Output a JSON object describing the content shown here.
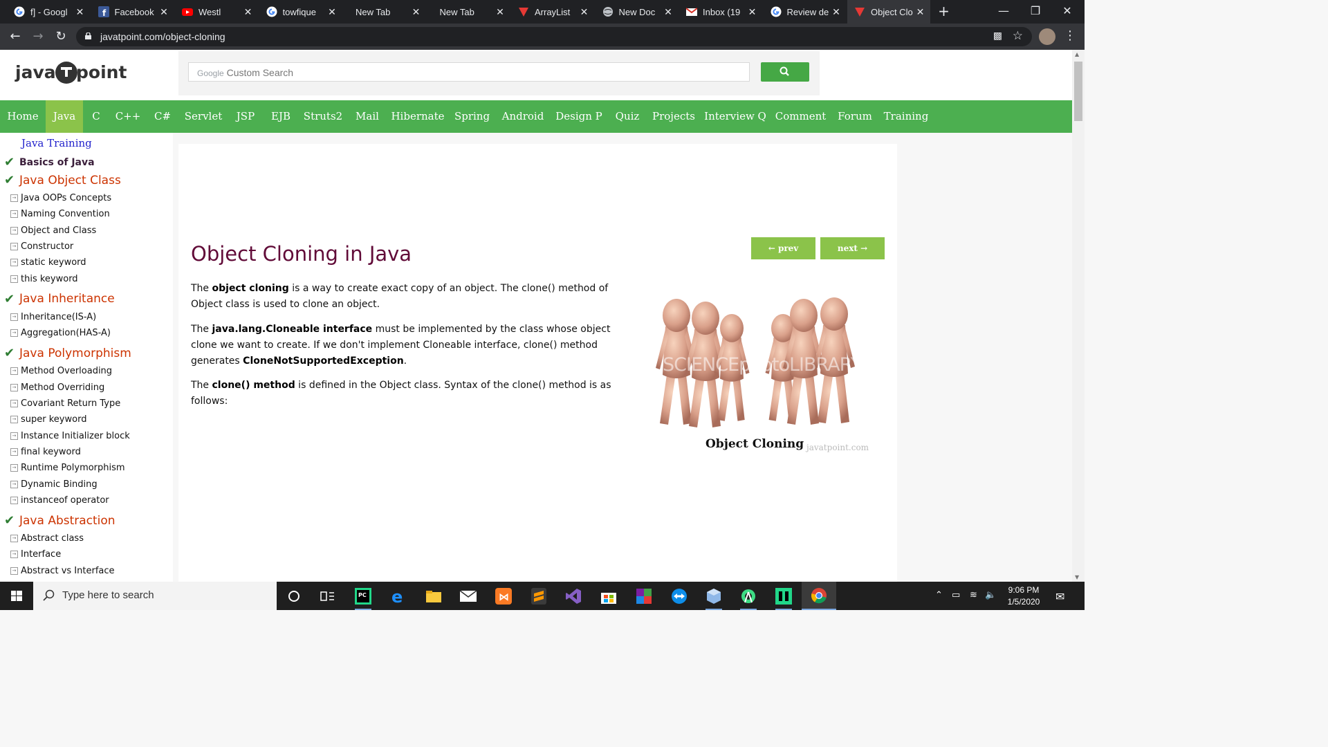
{
  "browser": {
    "tabs": [
      {
        "title": "f] - Googl",
        "icon": "google-icon",
        "active": false
      },
      {
        "title": "Facebook",
        "icon": "facebook-icon",
        "active": false
      },
      {
        "title": "Westl",
        "icon": "youtube-icon",
        "active": false
      },
      {
        "title": "towfique",
        "icon": "google-icon",
        "active": false
      },
      {
        "title": "New Tab",
        "icon": "none",
        "active": false
      },
      {
        "title": "New Tab",
        "icon": "none",
        "active": false
      },
      {
        "title": "ArrayList",
        "icon": "javatpoint-icon",
        "active": false
      },
      {
        "title": "New Doc",
        "icon": "globe-icon",
        "active": false
      },
      {
        "title": "Inbox (19",
        "icon": "gmail-icon",
        "active": false
      },
      {
        "title": "Review de",
        "icon": "google-icon",
        "active": false
      },
      {
        "title": "Object Clo",
        "icon": "javatpoint-icon",
        "active": true
      }
    ],
    "url": "javatpoint.com/object-cloning"
  },
  "site": {
    "logo_left": "java",
    "logo_right": "point",
    "search_brand": "Google",
    "search_placeholder": "Custom Search",
    "nav": [
      "Home",
      "Java",
      "C",
      "C++",
      "C#",
      "Servlet",
      "JSP",
      "EJB",
      "Struts2",
      "Mail",
      "Hibernate",
      "Spring",
      "Android",
      "Design P",
      "Quiz",
      "Projects",
      "Interview Q",
      "Comment",
      "Forum",
      "Training"
    ],
    "nav_active": "Java"
  },
  "sidebar": {
    "heading": "Java Training",
    "sections": [
      {
        "title": "Basics of Java",
        "style": "basic",
        "items": []
      },
      {
        "title": "Java Object Class",
        "style": "big",
        "items": [
          "Java OOPs Concepts",
          "Naming Convention",
          "Object and Class",
          "Constructor",
          "static keyword",
          "this keyword"
        ]
      },
      {
        "title": "Java Inheritance",
        "style": "big",
        "items": [
          "Inheritance(IS-A)",
          "Aggregation(HAS-A)"
        ]
      },
      {
        "title": "Java Polymorphism",
        "style": "big",
        "items": [
          "Method Overloading",
          "Method Overriding",
          "Covariant Return Type",
          "super keyword",
          "Instance Initializer block",
          "final keyword",
          "Runtime Polymorphism",
          "Dynamic Binding",
          "instanceof operator"
        ]
      },
      {
        "title": "Java Abstraction",
        "style": "big",
        "items": [
          "Abstract class",
          "Interface",
          "Abstract vs Interface"
        ]
      }
    ]
  },
  "article": {
    "title": "Object Cloning in Java",
    "prev_label": "← prev",
    "next_label": "next →",
    "p1_pre": "The ",
    "p1_bold": "object cloning",
    "p1_post": " is a way to create exact copy of an object. The clone() method of Object class is used to clone an object.",
    "p2_pre": "The ",
    "p2_bold": "java.lang.Cloneable interface",
    "p2_mid": " must be implemented by the class whose object clone we want to create. If we don't implement Cloneable interface, clone() method generates ",
    "p2_bold2": "CloneNotSupportedException",
    "p2_post": ".",
    "p3_pre": "The ",
    "p3_bold": "clone() method",
    "p3_post": " is defined in the Object class. Syntax of the clone() method is as follows:",
    "figure_caption": "Object Cloning",
    "figure_site": "javatpoint.com",
    "figure_watermark": "SCIENCEphotoLIBRARY"
  },
  "taskbar": {
    "search_placeholder": "Type here to search",
    "time": "9:06 PM",
    "date": "1/5/2020",
    "apps": [
      "task-view-icon",
      "pycharm-icon",
      "edge-icon",
      "file-explorer-icon",
      "mail-icon",
      "xampp-icon",
      "sublime-icon",
      "visual-studio-icon",
      "store-icon",
      "winrar-icon",
      "teamviewer-icon",
      "virtualbox-icon",
      "android-studio-icon",
      "app-icon",
      "chrome-icon"
    ]
  }
}
